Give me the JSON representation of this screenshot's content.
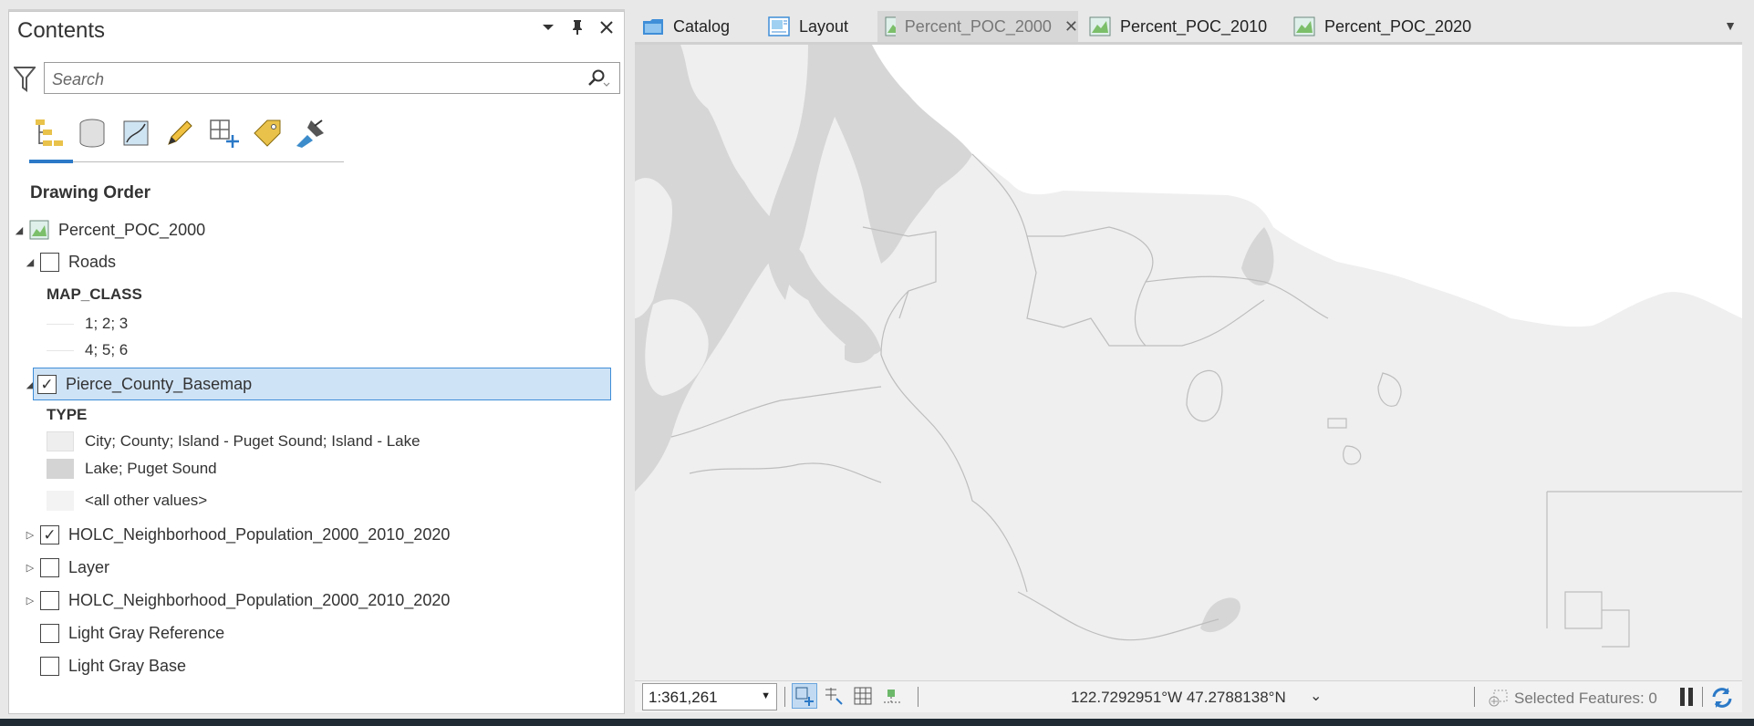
{
  "contents": {
    "title": "Contents",
    "search_placeholder": "Search",
    "section_title": "Drawing Order",
    "map_name": "Percent_POC_2000",
    "layers": [
      {
        "label": "Roads",
        "checked": false
      },
      {
        "label": "Pierce_County_Basemap",
        "checked": true
      },
      {
        "label": "HOLC_Neighborhood_Population_2000_2010_2020",
        "checked": true
      },
      {
        "label": "Layer",
        "checked": false
      },
      {
        "label": "HOLC_Neighborhood_Population_2000_2010_2020",
        "checked": false
      },
      {
        "label": "Light Gray Reference",
        "checked": false
      },
      {
        "label": "Light Gray Base",
        "checked": false
      }
    ],
    "roads_legend": {
      "heading": "MAP_CLASS",
      "items": [
        "1; 2; 3",
        "4; 5; 6"
      ]
    },
    "basemap_legend": {
      "heading": "TYPE",
      "items": [
        {
          "label": "City; County; Island - Puget Sound; Island - Lake",
          "color": "#eeeeee"
        },
        {
          "label": "Lake; Puget Sound",
          "color": "#d4d4d4"
        },
        {
          "label": "<all other values>",
          "color": "#f3f3f3"
        }
      ]
    }
  },
  "tabs": [
    {
      "label": "Catalog",
      "icon": "catalog-icon"
    },
    {
      "label": "Layout",
      "icon": "layout-icon"
    },
    {
      "label": "Percent_POC_2000",
      "icon": "map-icon",
      "active": true
    },
    {
      "label": "Percent_POC_2010",
      "icon": "map-icon"
    },
    {
      "label": "Percent_POC_2020",
      "icon": "map-icon"
    }
  ],
  "status": {
    "scale": "1:361,261",
    "coordinates": "122.7292951°W 47.2788138°N",
    "selected_features": "Selected Features: 0"
  },
  "colors": {
    "accent": "#2b79c7",
    "water": "#d6d6d6",
    "land": "#efefef",
    "selection": "#cfe3f6"
  }
}
